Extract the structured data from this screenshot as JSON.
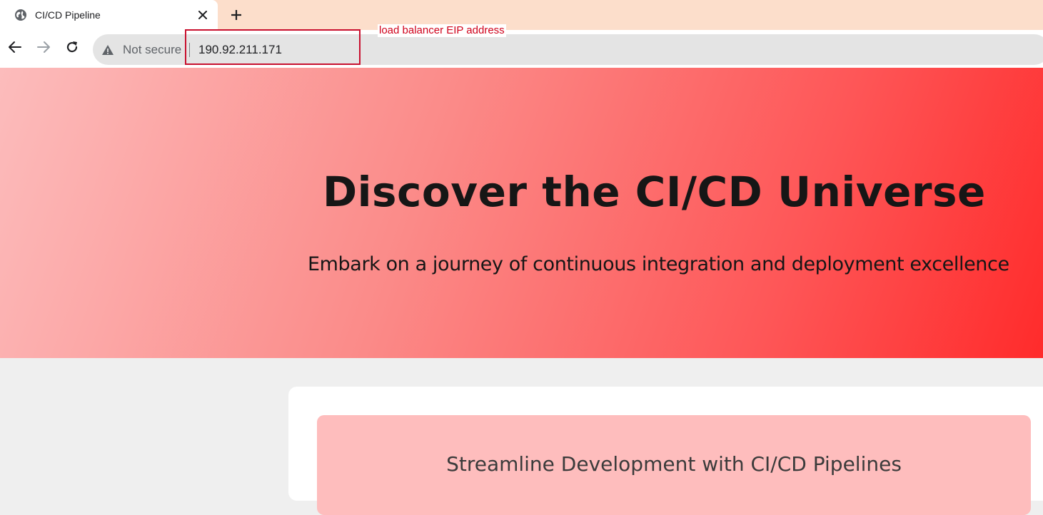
{
  "browser": {
    "tab": {
      "title": "CI/CD Pipeline",
      "favicon": "globe-icon"
    },
    "new_tab_icon": "plus-icon",
    "toolbar": {
      "back_icon": "arrow-left-icon",
      "forward_icon": "arrow-right-icon",
      "reload_icon": "reload-icon"
    },
    "omnibox": {
      "security_icon": "warning-triangle-icon",
      "security_text": "Not secure",
      "url": "190.92.211.171"
    },
    "tab_strip_color": "#fcdecb"
  },
  "annotation": {
    "label": "load balancer EIP address",
    "color": "#d0021b"
  },
  "hero": {
    "title": "Discover the CI/CD Universe",
    "subtitle": "Embark on a journey of continuous integration and deployment excellence",
    "gradient_start": "#fcbcbc",
    "gradient_end": "#ff2b2b"
  },
  "main": {
    "feature_card": {
      "heading": "Streamline Development with CI/CD Pipelines",
      "background": "#febdbd"
    }
  }
}
